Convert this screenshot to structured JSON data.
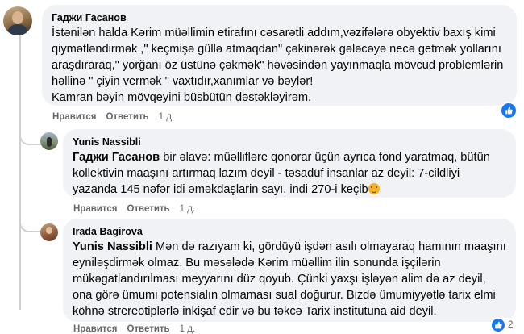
{
  "comments": [
    {
      "author": "Гаджи Гасанов",
      "lines": [
        "İstənilən halda Kərim müəllimin etirafını cəsarətli addım,vəzifələrə obyektiv baxış kimi",
        "qiymətləndirmək ,\" keçmişə güllə atmaqdan\" çəkinərək gələcəyə necə getmək yollarını",
        "araşdıraraq,\" yorğanı öz üstünə çəkmək\" həvəsindən yayınmaqla mövcud problemlərin",
        "həllinə \" çiyin vermək \" vaxtıdır,xanımlar və bəylər!",
        "Kamran bəyin mövqeyini büsbütün dəstəkləyirəm."
      ],
      "like": "Нравится",
      "reply": "Ответить",
      "time": "1 д."
    },
    {
      "author": "Yunis Nassibli",
      "mention": "Гаджи Гасанов",
      "lines": [
        " bir əlavə: müəllifləre qonorar üçün ayrıca fond yaratmaq, bütün",
        "kollektivin maaşını artırmaq lazım deyil - təsadüf insanlar az deyil: 7-cildliyi",
        "yazanda 145 nəfər idi əməkdaşlarin sayı, indi 270-i keçib"
      ],
      "like": "Нравится",
      "reply": "Ответить",
      "time": "1 д."
    },
    {
      "author": "Irada Bagirova",
      "mention": "Yunis Nassibli",
      "lines": [
        " Mən də razıyam ki, gördüyü işdən asılı olmayaraq hamının maaşını",
        "eyniləşdirmək olmaz. Bu məsələdə Kərim müəllim ilin sonunda işçilərin",
        "mükəgatlandırılması meyyarını düz qoyub. Çünki yaxşı işləyən alim də az deyil,",
        "ona görə ümumi potensialın olmaması sual doğurur. Bizdə ümumiyyətlə tarix elmi",
        "köhnə strereotiplərlə inkişaf edir və bu təkcə Tarix institutuna aid deyil."
      ],
      "like": "Нравится",
      "reply": "Ответить",
      "time": "1 д.",
      "reaction_count": "2"
    }
  ],
  "colors": {
    "bubble": "#f0f2f5",
    "like_blue": "#1877f2",
    "meta": "#65676b"
  },
  "icons": [
    "like-icon",
    "smile-emoji-icon"
  ]
}
